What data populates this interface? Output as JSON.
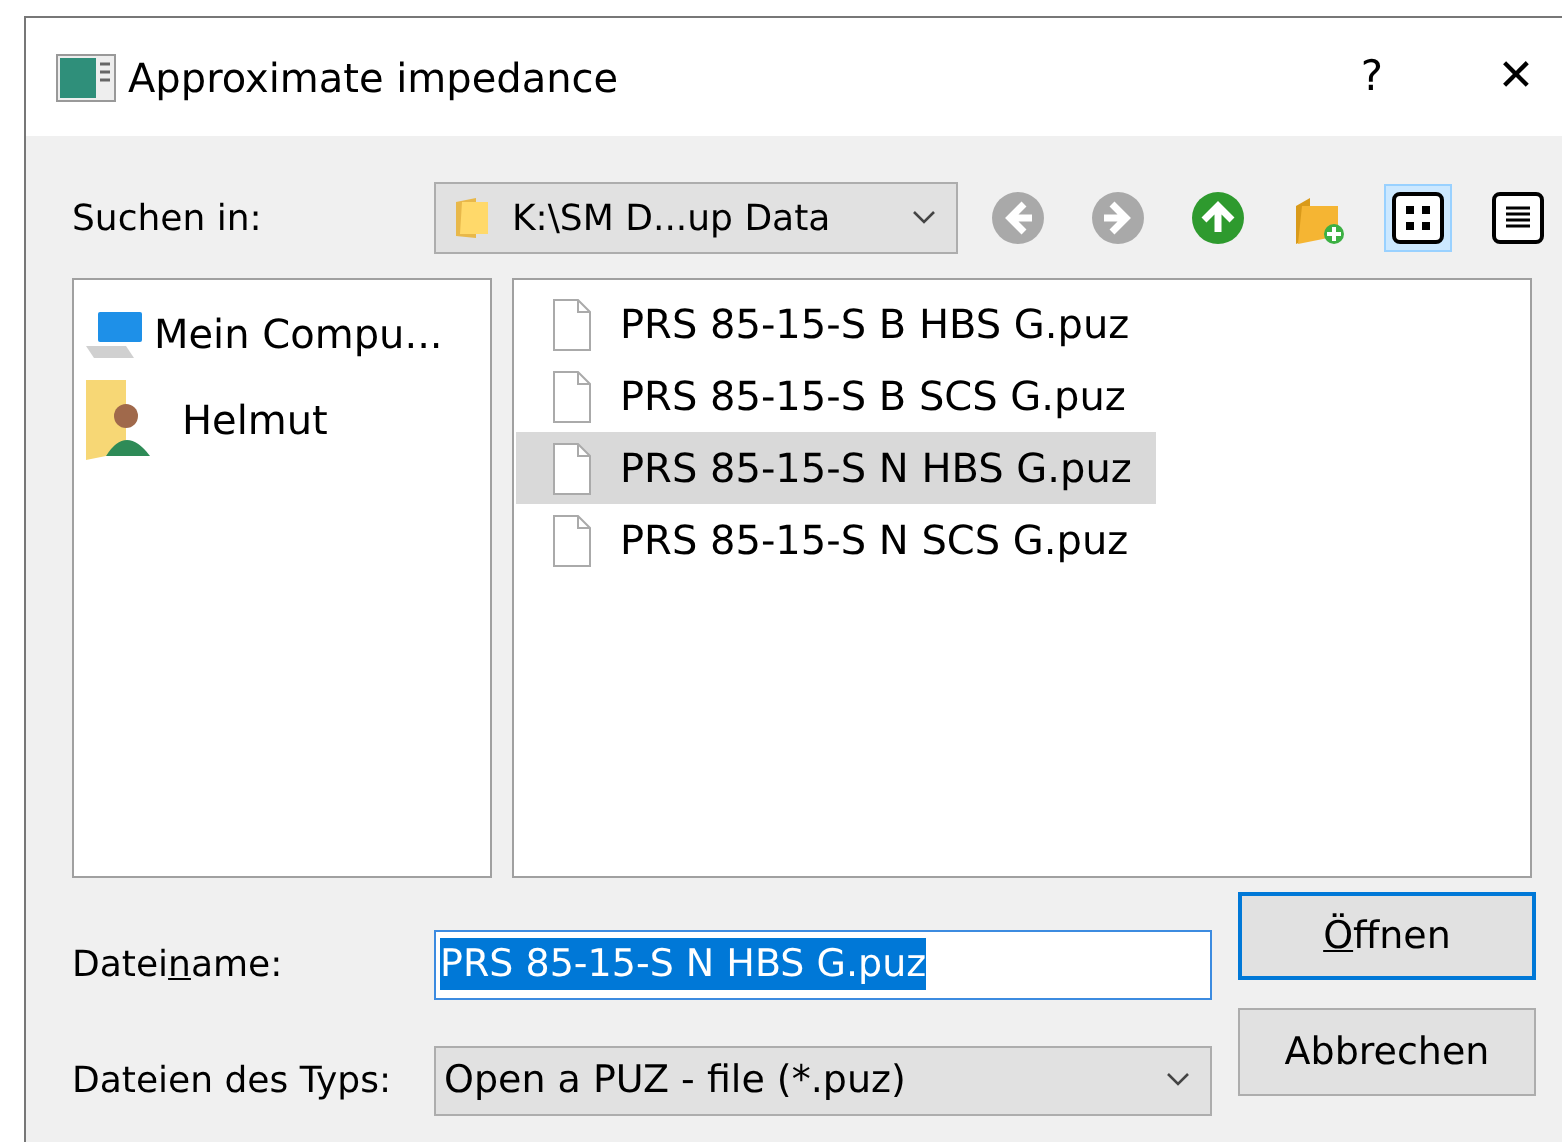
{
  "window": {
    "title": "Approximate impedance",
    "help": "?",
    "close": "✕"
  },
  "look_in": {
    "label": "Suchen in:",
    "value": "K:\\SM D...up Data"
  },
  "toolbar": [
    {
      "kind": "back",
      "selected": false
    },
    {
      "kind": "forward",
      "selected": false
    },
    {
      "kind": "up",
      "selected": false
    },
    {
      "kind": "new-folder",
      "selected": false
    },
    {
      "kind": "list-view",
      "selected": true
    },
    {
      "kind": "detail-view",
      "selected": false
    }
  ],
  "sidebar": {
    "items": [
      {
        "kind": "computer",
        "label": "Mein Compu..."
      },
      {
        "kind": "user",
        "label": "Helmut"
      }
    ]
  },
  "files": [
    {
      "name": "PRS 85-15-S B HBS G.puz",
      "selected": false
    },
    {
      "name": "PRS 85-15-S B SCS G.puz",
      "selected": false
    },
    {
      "name": "PRS 85-15-S N HBS G.puz",
      "selected": true
    },
    {
      "name": "PRS 85-15-S N SCS G.puz",
      "selected": false
    }
  ],
  "filename": {
    "label": {
      "before": "Datei",
      "key": "n",
      "after": "ame:"
    },
    "value": "PRS 85-15-S N HBS G.puz"
  },
  "filetype": {
    "label": "Dateien des Typs:",
    "value": "Open a PUZ - file (*.puz)"
  },
  "buttons": [
    {
      "key": "Ö",
      "after": "ffnen",
      "default": true
    },
    {
      "before": "Abbrechen",
      "default": false
    }
  ]
}
